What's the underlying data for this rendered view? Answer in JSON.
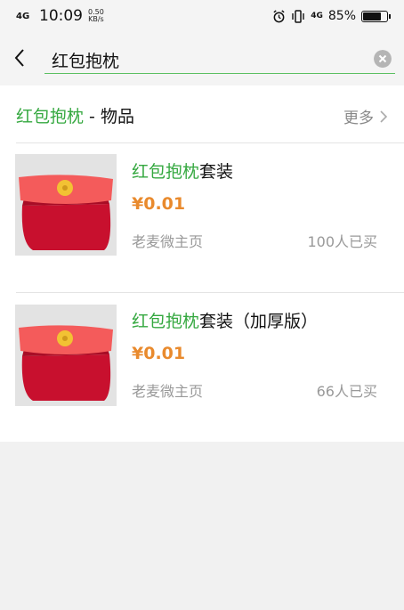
{
  "status_bar": {
    "network": "4G",
    "time": "10:09",
    "speed_value": "0.50",
    "speed_unit": "KB/s",
    "signal_right": "4G",
    "battery_percent": "85%",
    "battery_level": 0.85,
    "icons": [
      "alarm-icon",
      "vibrate-icon",
      "battery-icon"
    ]
  },
  "search": {
    "query": "红包抱枕"
  },
  "section": {
    "keyword": "红包抱枕",
    "suffix": " - 物品",
    "more_label": "更多"
  },
  "items": [
    {
      "title_keyword": "红包抱枕",
      "title_rest": "套装",
      "price": "¥0.01",
      "store": "老麦微主页",
      "sold": "100人已买"
    },
    {
      "title_keyword": "红包抱枕",
      "title_rest": "套装（加厚版）",
      "price": "¥0.01",
      "store": "老麦微主页",
      "sold": "66人已买"
    }
  ],
  "colors": {
    "accent_green": "#35a840",
    "price_orange": "#e98a2d",
    "pillow_red": "#c8102e",
    "flap_coral": "#f45b5b",
    "button_yellow": "#f2c233"
  }
}
